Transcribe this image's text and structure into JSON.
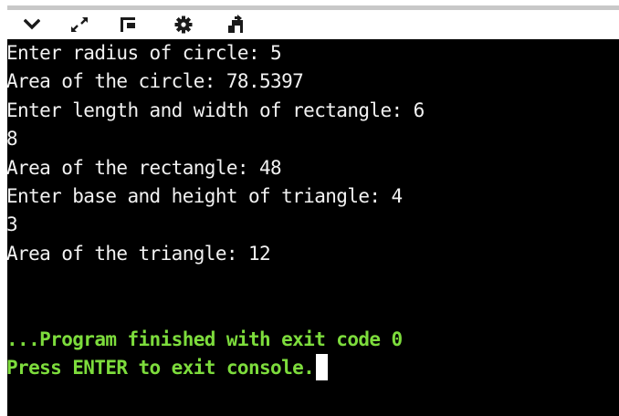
{
  "toolbar": {
    "buttons": [
      {
        "name": "collapse",
        "icon": "chevron-down-icon"
      },
      {
        "name": "expand",
        "icon": "expand-arrows-icon"
      },
      {
        "name": "layout",
        "icon": "layout-panel-icon"
      },
      {
        "name": "settings",
        "icon": "gear-icon"
      },
      {
        "name": "share",
        "icon": "share-icon"
      }
    ]
  },
  "console": {
    "lines": [
      "Enter radius of circle: 5",
      "Area of the circle: 78.5397",
      "Enter length and width of rectangle: 6",
      "8",
      "Area of the rectangle: 48",
      "Enter base and height of triangle: 4",
      "3",
      "Area of the triangle: 12"
    ],
    "status_finished": "...Program finished with exit code 0",
    "status_press": "Press ENTER to exit console."
  },
  "colors": {
    "console_bg": "#000000",
    "console_text": "#f2f2f2",
    "status_text": "#7ddc3c",
    "toolbar_strip": "#c8c8c8"
  }
}
